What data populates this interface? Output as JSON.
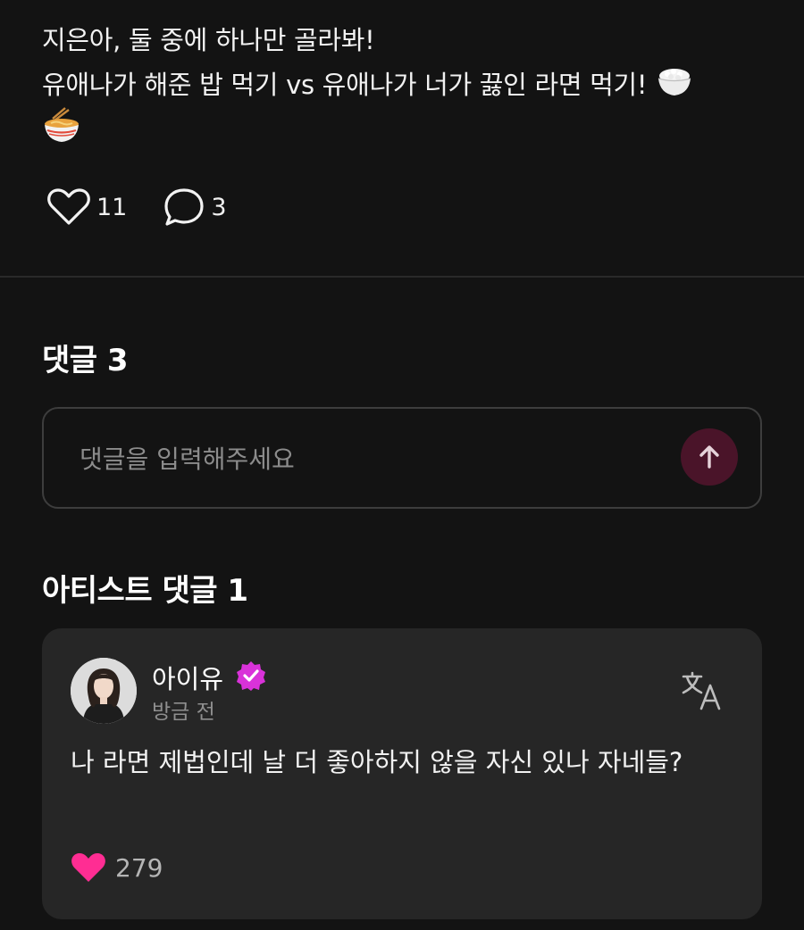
{
  "post": {
    "line1": "지은아, 둘 중에 하나만 골라봐!",
    "line2": "유애나가 해준 밥 먹기 vs 유애나가 너가 끓인 라면 먹기!",
    "emoji1_icon": "rice-bowl-icon",
    "emoji2_icon": "ramen-bowl-icon",
    "likes": "11",
    "comments": "3"
  },
  "comments_section": {
    "title": "댓글 3",
    "input_placeholder": "댓글을 입력해주세요"
  },
  "artist_section": {
    "title": "아티스트 댓글 1",
    "comment": {
      "author": "아이유",
      "time": "방금 전",
      "body": "나 라면 제법인데 날 더 좋아하지 않을 자신 있나 자네들?",
      "likes": "279"
    }
  },
  "colors": {
    "background": "#131313",
    "card": "#262626",
    "accent_pink": "#ff2d93",
    "verified_purple": "#d932d9",
    "send_button": "#4a1429"
  }
}
